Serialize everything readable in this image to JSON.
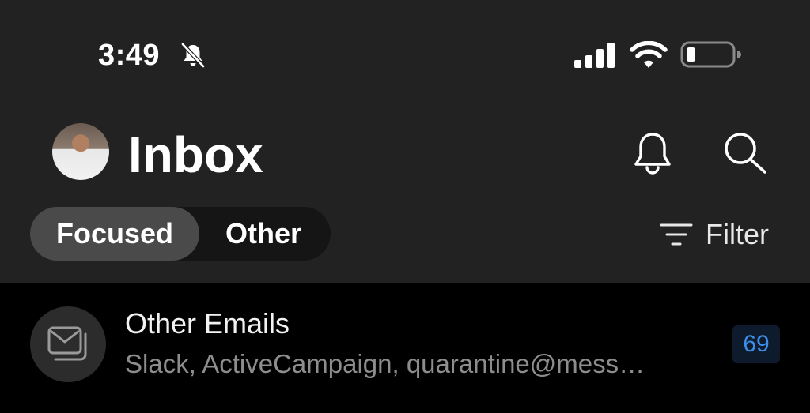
{
  "status_bar": {
    "time": "3:49",
    "icons": [
      "bell-slash-icon",
      "signal-icon",
      "wifi-icon",
      "battery-icon"
    ]
  },
  "header": {
    "title": "Inbox",
    "avatar": "avatar",
    "actions": [
      "bell-icon",
      "search-icon"
    ]
  },
  "tabs": {
    "items": [
      {
        "label": "Focused",
        "selected": true
      },
      {
        "label": "Other",
        "selected": false
      }
    ]
  },
  "filter": {
    "icon": "filter-lines-icon",
    "label": "Filter"
  },
  "list": {
    "items": [
      {
        "icon": "mail-stack-icon",
        "title": "Other Emails",
        "subtitle": "Slack, ActiveCampaign, quarantine@mess…",
        "count": "69"
      }
    ]
  },
  "colors": {
    "header_bg": "#222222",
    "list_bg": "#000000",
    "badge_text": "#3b8ee8",
    "badge_bg": "#0d1b2c"
  }
}
